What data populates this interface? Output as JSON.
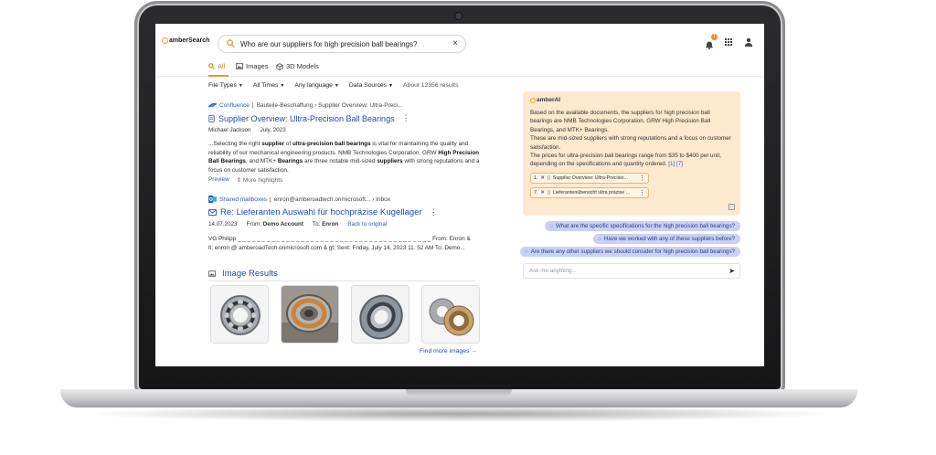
{
  "app": {
    "brand": "amberSearch",
    "notification_count": "1"
  },
  "search": {
    "query": "Who are our suppliers for high precision ball bearings?"
  },
  "tabs": [
    {
      "label": "All"
    },
    {
      "label": "Images"
    },
    {
      "label": "3D Models"
    }
  ],
  "filters": {
    "file_types": "File Types",
    "all_times": "All Times",
    "any_language": "Any language",
    "data_sources": "Data Sources",
    "count": "About 12356 results"
  },
  "results": [
    {
      "source": "Confluence",
      "path": "Bauteile-Beschaffung › Supplier Overview: Ultra-Preci...",
      "title": "Supplier Overview: Ultra-Precision Ball Bearings",
      "author": "Michael Jackson",
      "date": "July, 2023",
      "snippet_1": "...Selecting the right ",
      "snippet_b1": "supplier",
      "snippet_2": " of ",
      "snippet_b2": "ultra-precision ball bearings",
      "snippet_3": " is vital for maintaining the quality and reliability of our mechanical engineering products. NMB Technologies Corporation, GRW ",
      "snippet_b3": "High Precision Ball Bearings",
      "snippet_4": ", and MTK+ ",
      "snippet_b4": "Bearings",
      "snippet_5": " are three notable mid-sized ",
      "snippet_b5": "suppliers",
      "snippet_6": " with strong reputations and a focus on customer satisfaction.",
      "preview": "Preview",
      "more": "More highlights"
    },
    {
      "source": "Shared mailboxes",
      "path": "enron@amberoadtech.onmicrosoft... › Inbox",
      "title": "Re: Lieferanten Auswahl für hochpräzise Kugellager",
      "date": "14.07.2023",
      "from_label": "From:",
      "from": "Demo Account",
      "to_label": "To:",
      "to": "Enron",
      "back": "Back to original",
      "line1": "VG Philipp _ _ _ _ _ _ _ _ _ _ _ _ _ _ _ _ _ _ _ _ _ _ _ _ _ _ _ _ _ _ _ _ _ _ _ _ _ _ _ _ From: Enron &",
      "line2": "lt; enron @ amberoadTech.onmicrosoft.com & gt; Sent: Friday, July 14, 2023 11: 52 AM To: Demo..."
    }
  ],
  "images": {
    "title": "Image Results",
    "find_more": "Find more images →"
  },
  "ai": {
    "brand": "amberAI",
    "answer_1": "Based on the available documents, the suppliers for high precision ball bearings are NMB Technologies Corporation, GRW High Precision Ball Bearings, and MTK+ Bearings.",
    "answer_2": "These are mid-sized suppliers with strong reputations and a focus on customer satisfaction.",
    "answer_3": "The prices for ultra-precision ball bearings range from $35 to $400 per unit, depending on the specifications and quantity ordered.",
    "answer_refs": "[1] [7]",
    "ref1_num": "1.",
    "ref1": "Supplier Overview: Ultra-Precisio...",
    "ref2_num": "7.",
    "ref2": "Lieferantenübersicht ultra präzise ...",
    "suggestions": [
      "What are the specific specifications for the high precision ball bearings?",
      "Have we worked with any of these suppliers before?",
      "Are there any other suppliers we should consider for high precision ball bearings?"
    ],
    "ask_placeholder": "Ask me anything..."
  }
}
